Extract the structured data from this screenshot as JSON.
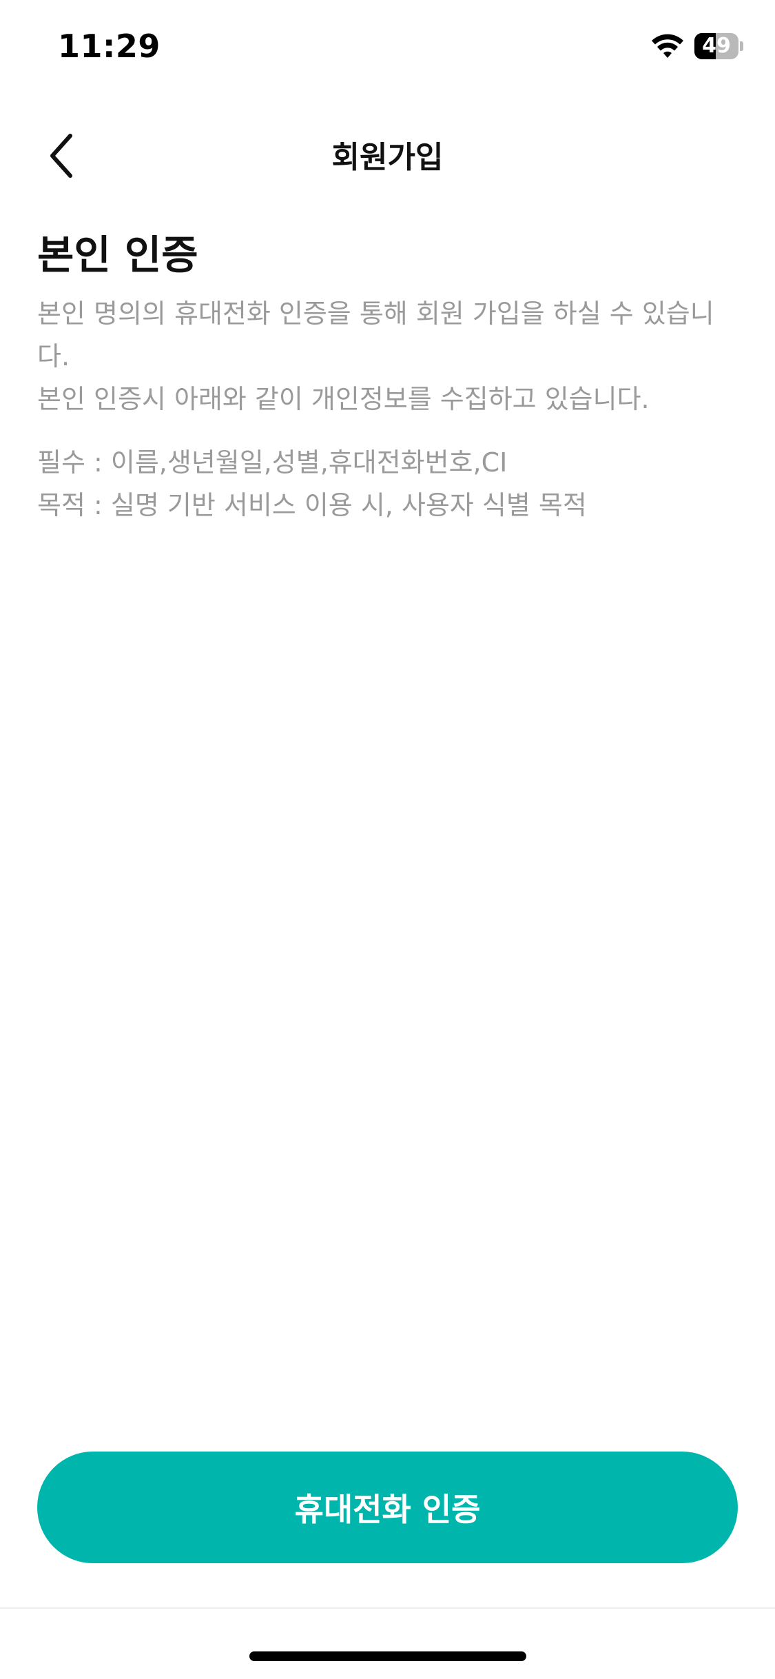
{
  "status_bar": {
    "time": "11:29",
    "battery_level": "49",
    "battery_fraction": 0.49
  },
  "nav": {
    "title": "회원가입",
    "back_icon": "chevron-left-icon"
  },
  "section": {
    "title": "본인 인증",
    "description_line1": "본인 명의의 휴대전화 인증을 통해 회원 가입을 하실 수 있습니",
    "description_line2": "다.",
    "description_line3": "본인 인증시 아래와 같이 개인정보를 수집하고 있습니다.",
    "required_line": "필수 : 이름,생년월일,성별,휴대전화번호,CI",
    "purpose_line": "목적 : 실명 기반 서비스 이용 시, 사용자 식별 목적"
  },
  "cta": {
    "label": "휴대전화 인증",
    "color": "#00b5ac"
  }
}
